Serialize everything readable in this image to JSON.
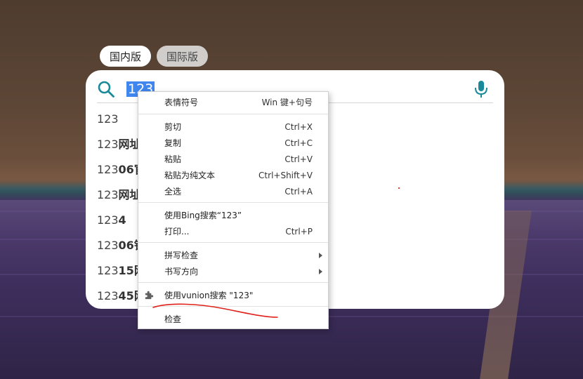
{
  "tabs": [
    {
      "label": "国内版",
      "active": true
    },
    {
      "label": "国际版",
      "active": false
    }
  ],
  "search": {
    "query": "123",
    "icon": "search-icon",
    "mic_icon": "microphone-icon",
    "accent_color": "#1a8a9a",
    "selection_color": "#3f86ee"
  },
  "suggestions": [
    {
      "prefix": "123",
      "bold": ""
    },
    {
      "prefix": "123",
      "bold": "网址"
    },
    {
      "prefix": "123",
      "bold": "06官"
    },
    {
      "prefix": "123",
      "bold": "网址"
    },
    {
      "prefix": "123",
      "bold": "4"
    },
    {
      "prefix": "123",
      "bold": "06铁"
    },
    {
      "prefix": "123",
      "bold": "15网"
    },
    {
      "prefix": "123",
      "bold": "45网"
    }
  ],
  "context_menu": {
    "items": [
      {
        "label": "表情符号",
        "shortcut": "Win 键+句号"
      },
      {
        "label": "剪切",
        "shortcut": "Ctrl+X"
      },
      {
        "label": "复制",
        "shortcut": "Ctrl+C"
      },
      {
        "label": "粘贴",
        "shortcut": "Ctrl+V"
      },
      {
        "label": "粘贴为纯文本",
        "shortcut": "Ctrl+Shift+V"
      },
      {
        "label": "全选",
        "shortcut": "Ctrl+A"
      },
      {
        "label": "使用Bing搜索“123”",
        "shortcut": ""
      },
      {
        "label": "打印...",
        "shortcut": "Ctrl+P"
      },
      {
        "label": "拼写检查",
        "shortcut": ""
      },
      {
        "label": "书写方向",
        "shortcut": ""
      },
      {
        "label": "使用vunion搜索 \"123\"",
        "shortcut": "",
        "icon": "puzzle-icon"
      },
      {
        "label": "检查",
        "shortcut": ""
      }
    ]
  },
  "annotation_color": "#e0201a"
}
